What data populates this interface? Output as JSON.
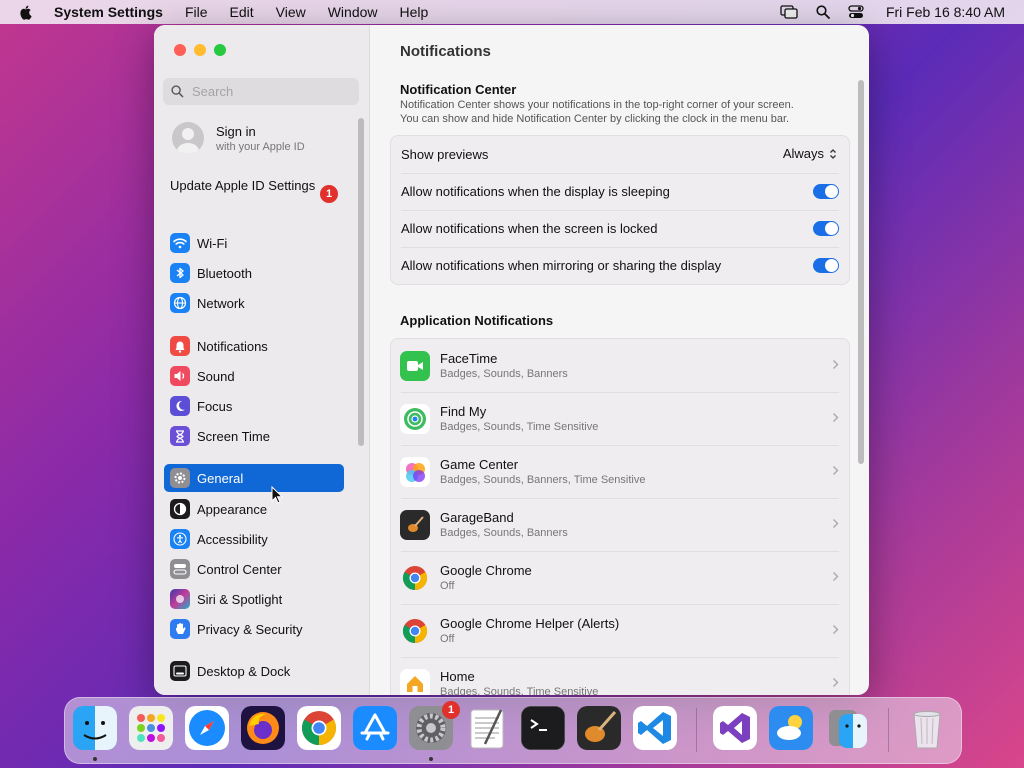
{
  "menubar": {
    "app": "System Settings",
    "items": [
      "File",
      "Edit",
      "View",
      "Window",
      "Help"
    ],
    "clock": "Fri Feb 16  8:40 AM"
  },
  "sidebar": {
    "search_placeholder": "Search",
    "signin_title": "Sign in",
    "signin_sub": "with your Apple ID",
    "update_label": "Update Apple ID Settings",
    "update_badge": "1",
    "items": [
      {
        "label": "Wi-Fi",
        "color": "#1a82f5"
      },
      {
        "label": "Bluetooth",
        "color": "#1a82f5"
      },
      {
        "label": "Network",
        "color": "#1a82f5"
      },
      {
        "label": "Notifications",
        "color": "#f04a44"
      },
      {
        "label": "Sound",
        "color": "#f04a60"
      },
      {
        "label": "Focus",
        "color": "#5c4fd6"
      },
      {
        "label": "Screen Time",
        "color": "#6b4fd6"
      },
      {
        "label": "General",
        "color": "#8e8e93"
      },
      {
        "label": "Appearance",
        "color": "#1c1c1e"
      },
      {
        "label": "Accessibility",
        "color": "#1a82f5"
      },
      {
        "label": "Control Center",
        "color": "#8e8e93"
      },
      {
        "label": "Siri & Spotlight",
        "color": "#3b3b8f"
      },
      {
        "label": "Privacy & Security",
        "color": "#2f7bf0"
      },
      {
        "label": "Desktop & Dock",
        "color": "#1c1c1e"
      }
    ]
  },
  "main": {
    "title": "Notifications",
    "nc_title": "Notification Center",
    "nc_desc_1": "Notification Center shows your notifications in the top-right corner of your screen.",
    "nc_desc_2": "You can show and hide Notification Center by clicking the clock in the menu bar.",
    "show_previews_label": "Show previews",
    "show_previews_value": "Always",
    "toggles": [
      "Allow notifications when the display is sleeping",
      "Allow notifications when the screen is locked",
      "Allow notifications when mirroring or sharing the display"
    ],
    "app_title": "Application Notifications",
    "apps": [
      {
        "name": "FaceTime",
        "desc": "Badges, Sounds, Banners"
      },
      {
        "name": "Find My",
        "desc": "Badges, Sounds, Time Sensitive"
      },
      {
        "name": "Game Center",
        "desc": "Badges, Sounds, Banners, Time Sensitive"
      },
      {
        "name": "GarageBand",
        "desc": "Badges, Sounds, Banners"
      },
      {
        "name": "Google Chrome",
        "desc": "Off"
      },
      {
        "name": "Google Chrome Helper (Alerts)",
        "desc": "Off"
      },
      {
        "name": "Home",
        "desc": "Badges, Sounds, Time Sensitive"
      }
    ]
  },
  "dock": {
    "settings_badge": "1"
  }
}
